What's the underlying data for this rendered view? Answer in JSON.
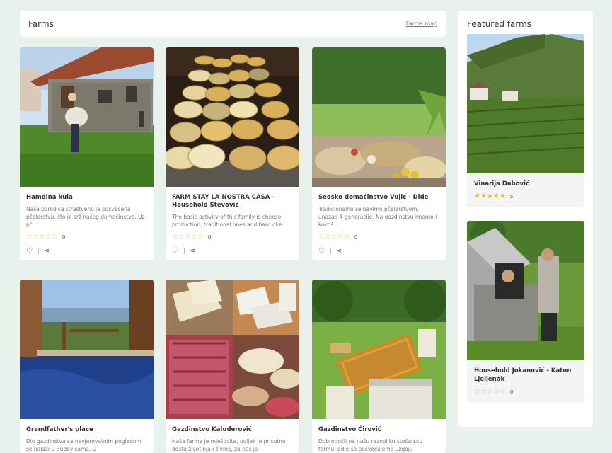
{
  "main": {
    "title": "Farms",
    "map_link": "Farms map"
  },
  "farms": [
    {
      "name": "Hamdina kula",
      "desc": "Naša porodica strastveno je posvećena pčelarstvu, što je srž našeg domaćinstva. Uz pč...",
      "rating": 0,
      "count": "0"
    },
    {
      "name": "FARM STAY LA NOSTRA CASA - Household Stevović",
      "desc": "The basic activity of this family is cheese production, traditional ones and hard che...",
      "rating": 0,
      "count": "0"
    },
    {
      "name": "Seosko domaćinstvo Vujić - Dide",
      "desc": "Tradicionalno se bavimo pčelarstvom, unazad 4 generacije. Na gazdinstvu imamo i kokoš...",
      "rating": 0,
      "count": "0"
    },
    {
      "name": "Grandfather's place",
      "desc": "Dio gazdinstva sa nevjerovatnim pogledom se nalazi u Budevicama. U"
    },
    {
      "name": "Gazdinstvo Kaluđerović",
      "desc": "Naša farma je mješovita, uvijek je prisutno dosta životinja i živine, za nas je"
    },
    {
      "name": "Gazdinstvo Ćirović",
      "desc": "Dobrodošli na našu raznoliku stočarsku farmu, gdje se posvećujemo uzgoju"
    }
  ],
  "sidebar": {
    "title": "Featured farms",
    "items": [
      {
        "name": "Vinarija Dabović",
        "rating": 5,
        "count": "5"
      },
      {
        "name": "Household Jokanović - Katun Ljeljenak",
        "rating": 0,
        "count": "0"
      }
    ]
  },
  "icons": {
    "heart": "heart-icon",
    "share": "share-icon",
    "star": "star-icon"
  },
  "colors": {
    "background": "#e9f1ec",
    "link": "#5b8f6e",
    "star": "#e8b73a"
  }
}
